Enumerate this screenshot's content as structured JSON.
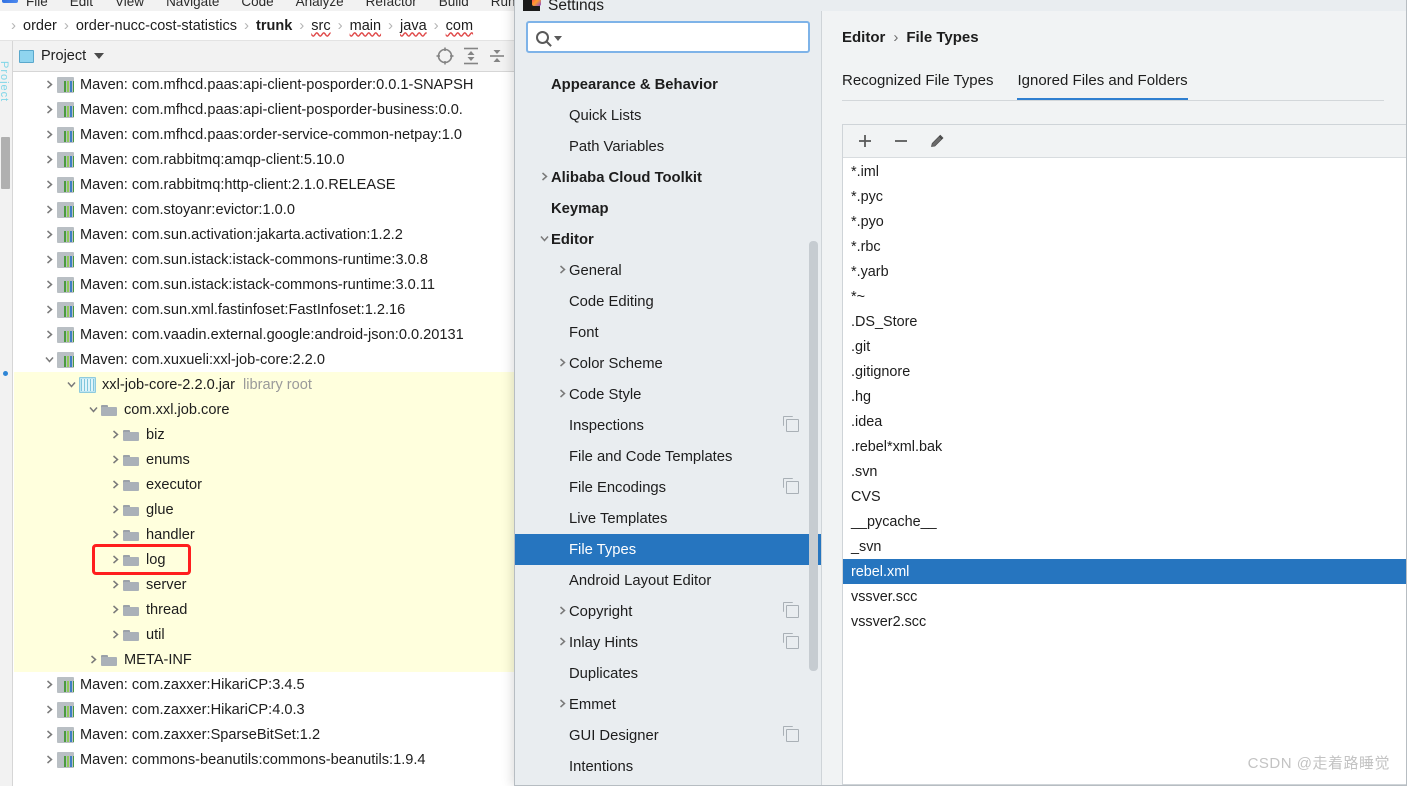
{
  "menubar": {
    "items": [
      "File",
      "Edit",
      "View",
      "Navigate",
      "Code",
      "Analyze",
      "Refactor",
      "Build",
      "Run"
    ]
  },
  "breadcrumb": {
    "items": [
      {
        "label": "order",
        "bold": false,
        "squiggle": false
      },
      {
        "label": "order-nucc-cost-statistics",
        "bold": false,
        "squiggle": false
      },
      {
        "label": "trunk",
        "bold": true,
        "squiggle": false
      },
      {
        "label": "src",
        "bold": false,
        "squiggle": true
      },
      {
        "label": "main",
        "bold": false,
        "squiggle": true
      },
      {
        "label": "java",
        "bold": false,
        "squiggle": true
      },
      {
        "label": "com",
        "bold": false,
        "squiggle": true
      }
    ]
  },
  "tool_strip": {
    "label": "Project"
  },
  "project_panel": {
    "title": "Project",
    "icons": [
      "locate-icon",
      "expand-all-icon",
      "collapse-all-icon"
    ]
  },
  "project_tree": [
    {
      "label": "Maven: com.mfhcd.paas:api-client-posporder:0.0.1-SNAPSH",
      "icon": "maven-icon",
      "arrow": "right",
      "indent": 0,
      "highlight": false
    },
    {
      "label": "Maven: com.mfhcd.paas:api-client-posporder-business:0.0.",
      "icon": "maven-icon",
      "arrow": "right",
      "indent": 0,
      "highlight": false
    },
    {
      "label": "Maven: com.mfhcd.paas:order-service-common-netpay:1.0",
      "icon": "maven-icon",
      "arrow": "right",
      "indent": 0,
      "highlight": false
    },
    {
      "label": "Maven: com.rabbitmq:amqp-client:5.10.0",
      "icon": "maven-icon",
      "arrow": "right",
      "indent": 0,
      "highlight": false
    },
    {
      "label": "Maven: com.rabbitmq:http-client:2.1.0.RELEASE",
      "icon": "maven-icon",
      "arrow": "right",
      "indent": 0,
      "highlight": false
    },
    {
      "label": "Maven: com.stoyanr:evictor:1.0.0",
      "icon": "maven-icon",
      "arrow": "right",
      "indent": 0,
      "highlight": false
    },
    {
      "label": "Maven: com.sun.activation:jakarta.activation:1.2.2",
      "icon": "maven-icon",
      "arrow": "right",
      "indent": 0,
      "highlight": false
    },
    {
      "label": "Maven: com.sun.istack:istack-commons-runtime:3.0.8",
      "icon": "maven-icon",
      "arrow": "right",
      "indent": 0,
      "highlight": false
    },
    {
      "label": "Maven: com.sun.istack:istack-commons-runtime:3.0.11",
      "icon": "maven-icon",
      "arrow": "right",
      "indent": 0,
      "highlight": false
    },
    {
      "label": "Maven: com.sun.xml.fastinfoset:FastInfoset:1.2.16",
      "icon": "maven-icon",
      "arrow": "right",
      "indent": 0,
      "highlight": false
    },
    {
      "label": "Maven: com.vaadin.external.google:android-json:0.0.20131",
      "icon": "maven-icon",
      "arrow": "right",
      "indent": 0,
      "highlight": false
    },
    {
      "label": "Maven: com.xuxueli:xxl-job-core:2.2.0",
      "icon": "maven-icon",
      "arrow": "down",
      "indent": 0,
      "highlight": false
    },
    {
      "label": "xxl-job-core-2.2.0.jar",
      "suffix": "library root",
      "icon": "jar-icon",
      "arrow": "down",
      "indent": 1,
      "highlight": true
    },
    {
      "label": "com.xxl.job.core",
      "icon": "folder-icon",
      "arrow": "down",
      "indent": 2,
      "highlight": true
    },
    {
      "label": "biz",
      "icon": "folder-icon",
      "arrow": "right",
      "indent": 3,
      "highlight": true
    },
    {
      "label": "enums",
      "icon": "folder-icon",
      "arrow": "right",
      "indent": 3,
      "highlight": true
    },
    {
      "label": "executor",
      "icon": "folder-icon",
      "arrow": "right",
      "indent": 3,
      "highlight": true
    },
    {
      "label": "glue",
      "icon": "folder-icon",
      "arrow": "right",
      "indent": 3,
      "highlight": true
    },
    {
      "label": "handler",
      "icon": "folder-icon",
      "arrow": "right",
      "indent": 3,
      "highlight": true
    },
    {
      "label": "log",
      "icon": "folder-icon",
      "arrow": "right",
      "indent": 3,
      "highlight": true,
      "annotated": true
    },
    {
      "label": "server",
      "icon": "folder-icon",
      "arrow": "right",
      "indent": 3,
      "highlight": true
    },
    {
      "label": "thread",
      "icon": "folder-icon",
      "arrow": "right",
      "indent": 3,
      "highlight": true
    },
    {
      "label": "util",
      "icon": "folder-icon",
      "arrow": "right",
      "indent": 3,
      "highlight": true
    },
    {
      "label": "META-INF",
      "icon": "folder-icon",
      "arrow": "right",
      "indent": 2,
      "highlight": true
    },
    {
      "label": "Maven: com.zaxxer:HikariCP:3.4.5",
      "icon": "maven-icon",
      "arrow": "right",
      "indent": 0,
      "highlight": false
    },
    {
      "label": "Maven: com.zaxxer:HikariCP:4.0.3",
      "icon": "maven-icon",
      "arrow": "right",
      "indent": 0,
      "highlight": false
    },
    {
      "label": "Maven: com.zaxxer:SparseBitSet:1.2",
      "icon": "maven-icon",
      "arrow": "right",
      "indent": 0,
      "highlight": false
    },
    {
      "label": "Maven: commons-beanutils:commons-beanutils:1.9.4",
      "icon": "maven-icon",
      "arrow": "right",
      "indent": 0,
      "highlight": false
    }
  ],
  "dialog": {
    "title": "Settings",
    "search": {
      "value": "",
      "placeholder": ""
    },
    "nav": [
      {
        "label": "Appearance & Behavior",
        "bold": true,
        "arrow": "none",
        "indent": 0,
        "copy": false,
        "selected": false
      },
      {
        "label": "Quick Lists",
        "bold": false,
        "arrow": "none",
        "indent": 1,
        "copy": false,
        "selected": false
      },
      {
        "label": "Path Variables",
        "bold": false,
        "arrow": "none",
        "indent": 1,
        "copy": false,
        "selected": false
      },
      {
        "label": "Alibaba Cloud Toolkit",
        "bold": true,
        "arrow": "right",
        "indent": 0,
        "copy": false,
        "selected": false
      },
      {
        "label": "Keymap",
        "bold": true,
        "arrow": "none",
        "indent": 0,
        "copy": false,
        "selected": false
      },
      {
        "label": "Editor",
        "bold": true,
        "arrow": "down",
        "indent": 0,
        "copy": false,
        "selected": false
      },
      {
        "label": "General",
        "bold": false,
        "arrow": "right",
        "indent": 1,
        "copy": false,
        "selected": false
      },
      {
        "label": "Code Editing",
        "bold": false,
        "arrow": "none",
        "indent": 1,
        "copy": false,
        "selected": false
      },
      {
        "label": "Font",
        "bold": false,
        "arrow": "none",
        "indent": 1,
        "copy": false,
        "selected": false
      },
      {
        "label": "Color Scheme",
        "bold": false,
        "arrow": "right",
        "indent": 1,
        "copy": false,
        "selected": false
      },
      {
        "label": "Code Style",
        "bold": false,
        "arrow": "right",
        "indent": 1,
        "copy": false,
        "selected": false
      },
      {
        "label": "Inspections",
        "bold": false,
        "arrow": "none",
        "indent": 1,
        "copy": true,
        "selected": false
      },
      {
        "label": "File and Code Templates",
        "bold": false,
        "arrow": "none",
        "indent": 1,
        "copy": false,
        "selected": false
      },
      {
        "label": "File Encodings",
        "bold": false,
        "arrow": "none",
        "indent": 1,
        "copy": true,
        "selected": false
      },
      {
        "label": "Live Templates",
        "bold": false,
        "arrow": "none",
        "indent": 1,
        "copy": false,
        "selected": false
      },
      {
        "label": "File Types",
        "bold": false,
        "arrow": "none",
        "indent": 1,
        "copy": false,
        "selected": true
      },
      {
        "label": "Android Layout Editor",
        "bold": false,
        "arrow": "none",
        "indent": 1,
        "copy": false,
        "selected": false
      },
      {
        "label": "Copyright",
        "bold": false,
        "arrow": "right",
        "indent": 1,
        "copy": true,
        "selected": false
      },
      {
        "label": "Inlay Hints",
        "bold": false,
        "arrow": "right",
        "indent": 1,
        "copy": true,
        "selected": false
      },
      {
        "label": "Duplicates",
        "bold": false,
        "arrow": "none",
        "indent": 1,
        "copy": false,
        "selected": false
      },
      {
        "label": "Emmet",
        "bold": false,
        "arrow": "right",
        "indent": 1,
        "copy": false,
        "selected": false
      },
      {
        "label": "GUI Designer",
        "bold": false,
        "arrow": "none",
        "indent": 1,
        "copy": true,
        "selected": false
      },
      {
        "label": "Intentions",
        "bold": false,
        "arrow": "none",
        "indent": 1,
        "copy": false,
        "selected": false
      }
    ],
    "pane": {
      "breadcrumb": [
        "Editor",
        "File Types"
      ],
      "breadcrumb_separator": "›",
      "tabs": [
        {
          "label": "Recognized File Types",
          "active": false
        },
        {
          "label": "Ignored Files and Folders",
          "active": true
        }
      ],
      "toolbar": [
        {
          "name": "add-icon",
          "glyph": "+"
        },
        {
          "name": "remove-icon",
          "glyph": "−"
        },
        {
          "name": "edit-pencil-icon",
          "glyph": "✎"
        }
      ],
      "ignored_list": [
        {
          "label": "*.iml",
          "selected": false
        },
        {
          "label": "*.pyc",
          "selected": false
        },
        {
          "label": "*.pyo",
          "selected": false
        },
        {
          "label": "*.rbc",
          "selected": false
        },
        {
          "label": "*.yarb",
          "selected": false
        },
        {
          "label": "*~",
          "selected": false
        },
        {
          "label": ".DS_Store",
          "selected": false
        },
        {
          "label": ".git",
          "selected": false
        },
        {
          "label": ".gitignore",
          "selected": false
        },
        {
          "label": ".hg",
          "selected": false
        },
        {
          "label": ".idea",
          "selected": false
        },
        {
          "label": ".rebel*xml.bak",
          "selected": false
        },
        {
          "label": ".svn",
          "selected": false
        },
        {
          "label": "CVS",
          "selected": false
        },
        {
          "label": "__pycache__",
          "selected": false
        },
        {
          "label": "_svn",
          "selected": false
        },
        {
          "label": "rebel.xml",
          "selected": true
        },
        {
          "label": "vssver.scc",
          "selected": false
        },
        {
          "label": "vssver2.scc",
          "selected": false
        }
      ]
    }
  },
  "watermark": "CSDN @走着路睡觉",
  "colors": {
    "selection_blue": "#2675bf",
    "tree_highlight_yellow": "#ffffdd",
    "annotation_red": "#ff1e1e",
    "tab_underline": "#2f7fd0"
  }
}
